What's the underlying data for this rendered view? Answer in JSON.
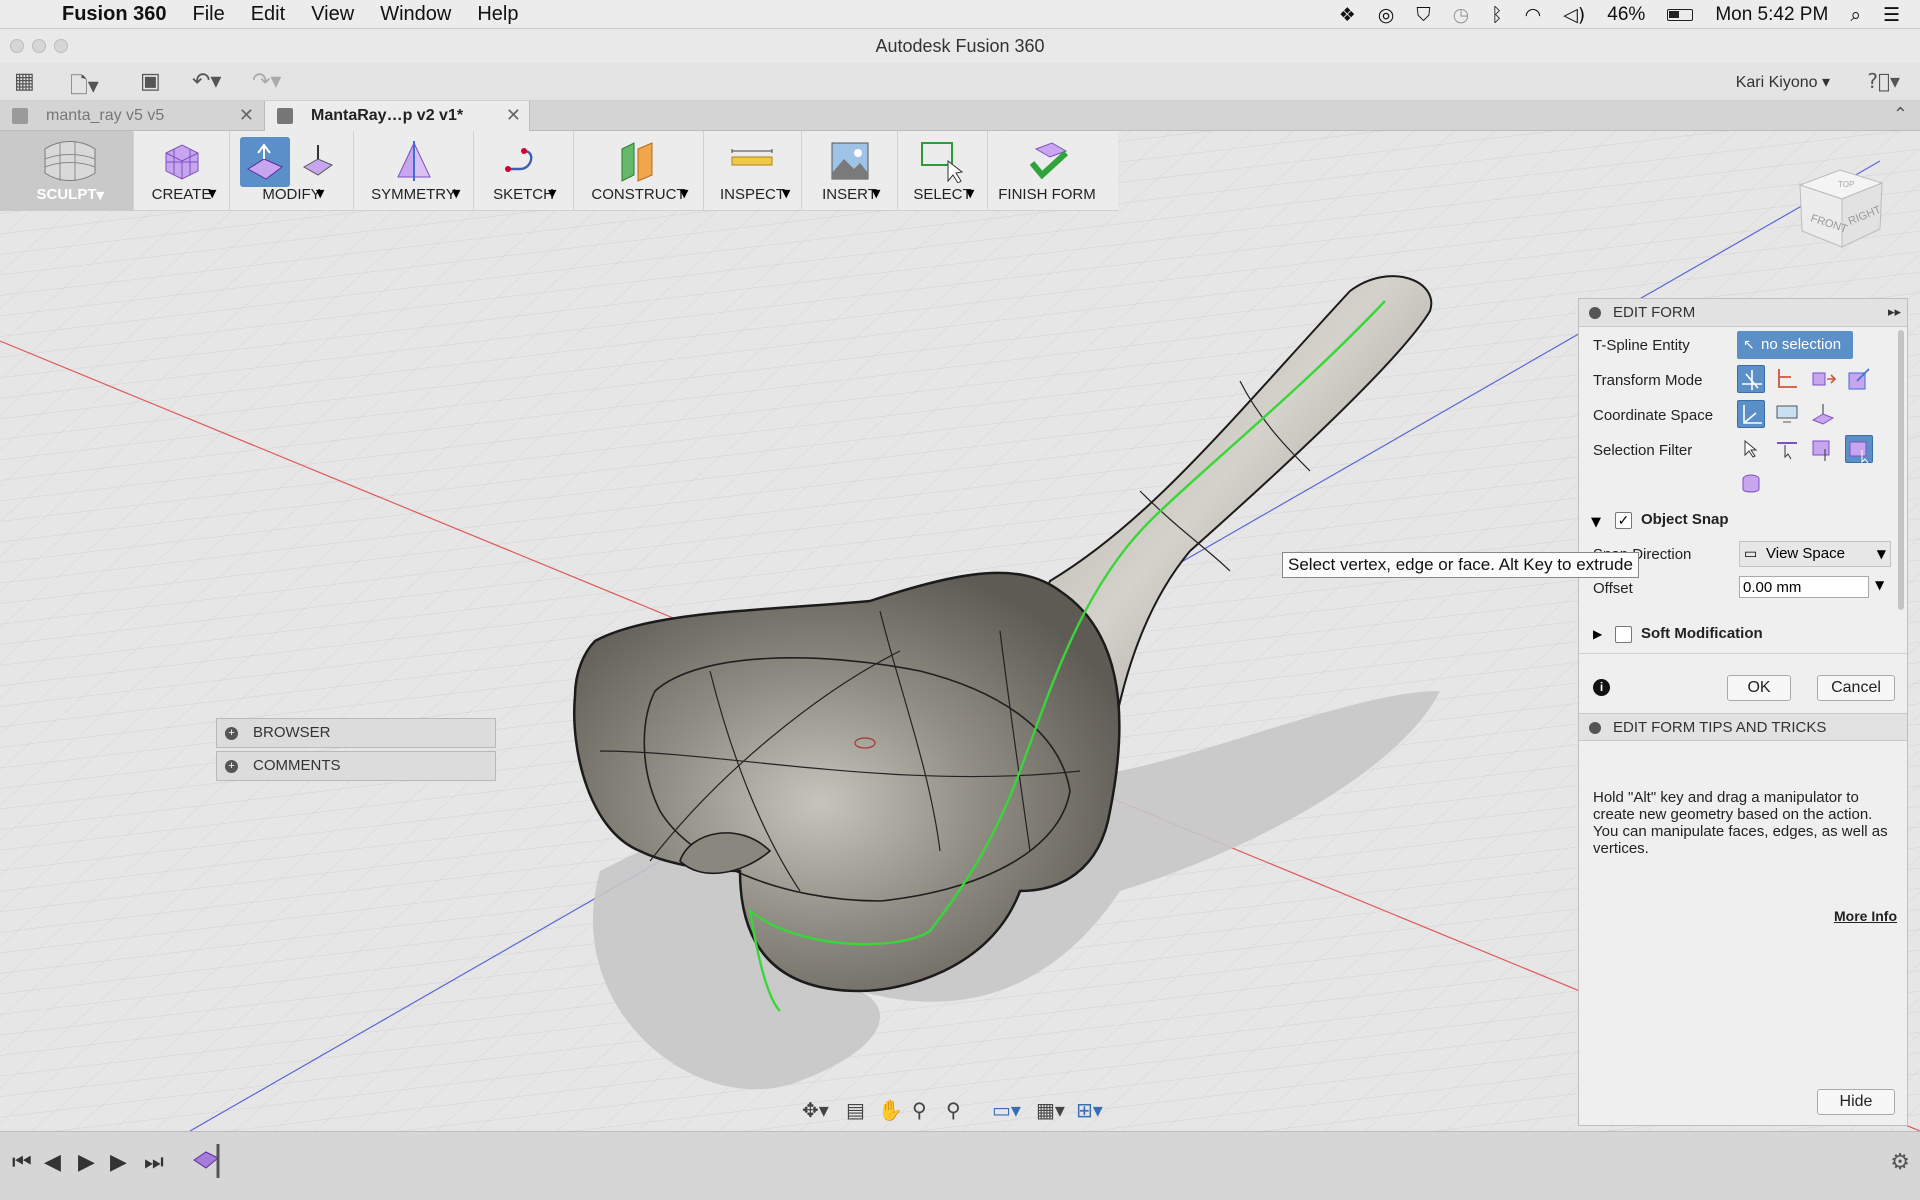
{
  "menubar": {
    "app_name": "Fusion 360",
    "menus": [
      "File",
      "Edit",
      "View",
      "Window",
      "Help"
    ],
    "battery": "46%",
    "clock": "Mon 5:42 PM"
  },
  "window": {
    "title": "Autodesk Fusion 360"
  },
  "apptoolbar": {
    "user": "Kari Kiyono ▾"
  },
  "tabs": [
    {
      "label": "manta_ray v5 v5"
    },
    {
      "label": "MantaRay…p v2 v1*"
    }
  ],
  "ribbon": {
    "sculpt": "SCULPT",
    "create": "CREATE",
    "modify": "MODIFY",
    "symmetry": "SYMMETRY",
    "sketch": "SKETCH",
    "construct": "CONSTRUCT",
    "inspect": "INSPECT",
    "insert": "INSERT",
    "select": "SELECT",
    "finish": "FINISH FORM"
  },
  "viewcube": {
    "front": "FRONT",
    "right": "RIGHT",
    "top": "TOP"
  },
  "browser": {
    "browser_label": "BROWSER",
    "comments_label": "COMMENTS"
  },
  "tooltip": "Select vertex, edge or face. Alt Key to extrude",
  "edit_form": {
    "title": "EDIT FORM",
    "tspline_label": "T-Spline Entity",
    "tspline_value": "no selection",
    "transform_label": "Transform Mode",
    "coord_label": "Coordinate Space",
    "filter_label": "Selection Filter",
    "object_snap": "Object Snap",
    "snap_direction_label": "Snap Direction",
    "snap_direction_value": "View Space",
    "offset_label": "Offset",
    "offset_value": "0.00 mm",
    "soft_mod": "Soft Modification",
    "ok": "OK",
    "cancel": "Cancel",
    "tips_title": "EDIT FORM TIPS AND TRICKS",
    "tips_text": "Hold \"Alt\" key and drag a manipulator to create new geometry based on the action. You can manipulate faces, edges, as well as vertices.",
    "more_info": "More Info",
    "hide": "Hide"
  },
  "colors": {
    "accent": "#5b8fc7",
    "purple": "#a77bd9",
    "x_axis": "#e05050",
    "z_axis": "#5060d0",
    "green_edge": "#39d63a"
  }
}
